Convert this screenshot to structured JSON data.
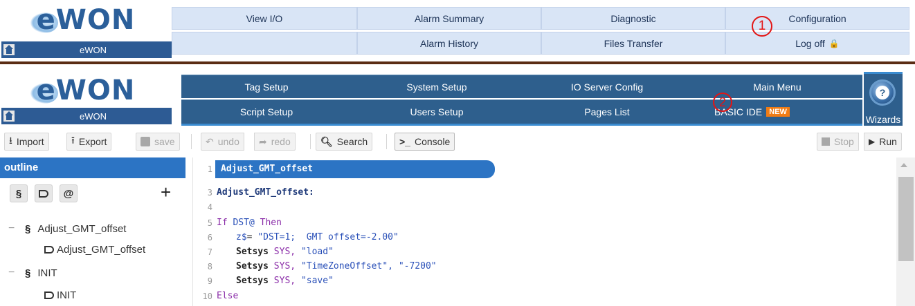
{
  "header1": {
    "logo_text": "eWON",
    "home_label": "eWON",
    "nav": [
      {
        "label": "View I/O"
      },
      {
        "label": "Alarm Summary"
      },
      {
        "label": "Diagnostic"
      },
      {
        "label": "Configuration"
      },
      {
        "label": ""
      },
      {
        "label": "Alarm History"
      },
      {
        "label": "Files Transfer"
      },
      {
        "label": "Log off"
      }
    ],
    "marker": "1"
  },
  "header2": {
    "logo_text": "eWON",
    "home_label": "eWON",
    "nav": [
      {
        "label": "Tag Setup"
      },
      {
        "label": "System Setup"
      },
      {
        "label": "IO Server Config"
      },
      {
        "label": "Main Menu"
      },
      {
        "label": "Script Setup"
      },
      {
        "label": "Users Setup"
      },
      {
        "label": "Pages List"
      },
      {
        "label": "BASIC IDE"
      }
    ],
    "new_badge": "NEW",
    "marker": "2",
    "wizards_label": "Wizards"
  },
  "toolbar": {
    "import": "Import",
    "export": "Export",
    "save": "save",
    "undo": "undo",
    "redo": "redo",
    "search": "Search",
    "console": "Console",
    "console_prefix": ">_",
    "stop": "Stop",
    "run": "Run"
  },
  "outline": {
    "title": "outline",
    "buttons": [
      "§",
      "",
      "@"
    ],
    "add": "+",
    "tree": [
      {
        "label": "Adjust_GMT_offset",
        "level": 0
      },
      {
        "label": "Adjust_GMT_offset",
        "level": 1
      },
      {
        "label": "INIT",
        "level": 0
      },
      {
        "label": "INIT",
        "level": 1
      }
    ]
  },
  "editor": {
    "line_numbers": [
      "1",
      "3",
      "4",
      "5",
      "6",
      "7",
      "8",
      "9",
      "10"
    ],
    "section_title": "Adjust_GMT_offset",
    "label_line": "Adjust_GMT_offset:",
    "line5": {
      "kw_if": "If",
      "var": "DST@",
      "kw_then": "Then"
    },
    "line6": {
      "var": "z$",
      "op": "=",
      "str": "\"DST=1;  GMT offset=-2.00\""
    },
    "line7": {
      "cmd": "Setsys",
      "arg": "SYS,",
      "str": "\"load\""
    },
    "line8": {
      "cmd": "Setsys",
      "arg": "SYS,",
      "str": "\"TimeZoneOffset\", \"-7200\""
    },
    "line9": {
      "cmd": "Setsys",
      "arg": "SYS,",
      "str": "\"save\""
    },
    "line10": {
      "kw_else": "Else"
    }
  },
  "colors": {
    "header1_nav": "#d9e5f6",
    "header2_nav": "#2e5f8d",
    "accent_blue": "#2c74c4",
    "marker_red": "#e31414",
    "new_badge": "#f07c14",
    "divider": "#5a2c14"
  }
}
